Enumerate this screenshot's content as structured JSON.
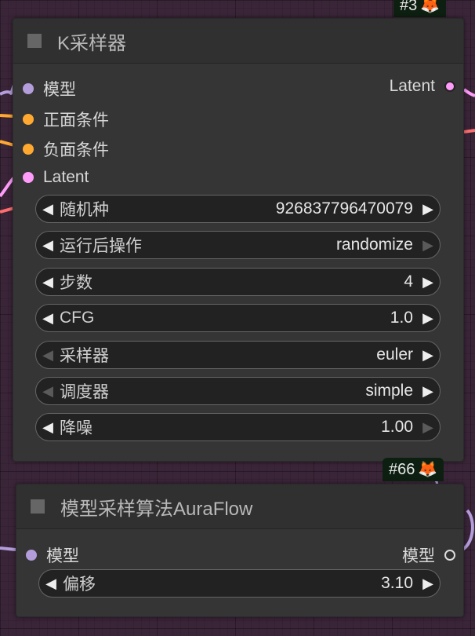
{
  "node1": {
    "badge_id": "#3",
    "title": "K采样器",
    "inputs": [
      {
        "label": "模型",
        "color": "#b39ddb"
      },
      {
        "label": "正面条件",
        "color": "#ffa931"
      },
      {
        "label": "负面条件",
        "color": "#ffa931"
      },
      {
        "label": "Latent",
        "color": "#ff9cf9"
      }
    ],
    "output": {
      "label": "Latent",
      "color": "#ff9cf9"
    },
    "widgets": [
      {
        "label": "随机种",
        "value": "926837796470079",
        "left_enabled": true,
        "right_enabled": true
      },
      {
        "label": "运行后操作",
        "value": "randomize",
        "left_enabled": true,
        "right_enabled": false
      },
      {
        "label": "步数",
        "value": "4",
        "left_enabled": true,
        "right_enabled": true
      },
      {
        "label": "CFG",
        "value": "1.0",
        "left_enabled": true,
        "right_enabled": true
      },
      {
        "label": "采样器",
        "value": "euler",
        "left_enabled": false,
        "right_enabled": true
      },
      {
        "label": "调度器",
        "value": "simple",
        "left_enabled": false,
        "right_enabled": true
      },
      {
        "label": "降噪",
        "value": "1.00",
        "left_enabled": true,
        "right_enabled": false
      }
    ]
  },
  "node2": {
    "badge_id": "#66",
    "title": "模型采样算法AuraFlow",
    "input": {
      "label": "模型",
      "color": "#b39ddb"
    },
    "output": {
      "label": "模型"
    },
    "widgets": [
      {
        "label": "偏移",
        "value": "3.10",
        "left_enabled": true,
        "right_enabled": true
      }
    ]
  },
  "icons": {
    "left_arrow": "◀",
    "right_arrow": "▶",
    "badge_icon": "fox-icon",
    "fox": "🦊"
  },
  "colors": {
    "model_wire": "#b39ddb",
    "conditioning_wire": "#ffa931",
    "latent_wire": "#ff9cf9",
    "red_wire": "#ff6e6e"
  }
}
